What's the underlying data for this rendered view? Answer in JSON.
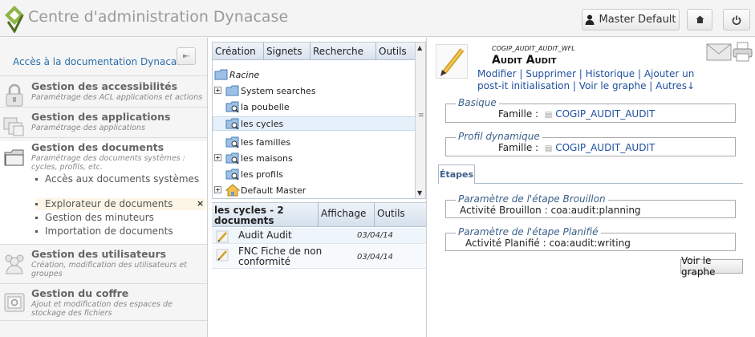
{
  "header": {
    "app_title": "Centre d'administration Dynacase",
    "user_label": "Master Default",
    "logo_icon": "dynacase-logo-icon",
    "user_icon": "user-icon",
    "home_icon": "home-icon",
    "power_icon": "power-icon"
  },
  "sidebar": {
    "doc_link": "Accès à la documentation Dynacase",
    "collapse_icon": "collapse-left-icon",
    "sections": [
      {
        "title": "Gestion des accessibilités",
        "subtitle": "Paramétrage des ACL applications et actions",
        "icon": "lock-icon"
      },
      {
        "title": "Gestion des applications",
        "subtitle": "Paramétrage des applications",
        "icon": "applications-icon"
      },
      {
        "title": "Gestion des documents",
        "subtitle": "Paramétrage des documents systèmes : cycles, profils, etc.",
        "icon": "documents-icon"
      },
      {
        "title": "Gestion des utilisateurs",
        "subtitle": "Création, modification des utilisateurs et groupes",
        "icon": "users-icon"
      },
      {
        "title": "Gestion du coffre",
        "subtitle": "Ajout et modification des espaces de stockage des fichiers",
        "icon": "vault-icon"
      }
    ],
    "doc_items": [
      "Accès aux documents systèmes",
      "Explorateur de documents",
      "Gestion des minuteurs",
      "Importation de documents"
    ],
    "close_mark": "×"
  },
  "explorer": {
    "menu": [
      "Création",
      "Signets",
      "Recherche",
      "Outils"
    ],
    "tree": [
      {
        "label": "Racine"
      },
      {
        "label": "System searches"
      },
      {
        "label": "la poubelle"
      },
      {
        "label": "les cycles"
      },
      {
        "label": "les familles"
      },
      {
        "label": "les maisons"
      },
      {
        "label": "les profils"
      },
      {
        "label": "Default Master"
      }
    ],
    "list_header": {
      "title": "les cycles - 2 documents",
      "col_display": "Affichage",
      "col_tools": "Outils"
    },
    "rows": [
      {
        "title": "Audit Audit",
        "date": "03/04/14"
      },
      {
        "title": "FNC Fiche de non conformité",
        "date": "03/04/14"
      }
    ],
    "scroll_up": "▲",
    "scroll_down": "▼",
    "scroll_grip": "≡"
  },
  "document": {
    "family": "COGIP_AUDIT_AUDIT_WFL",
    "title": "Audit Audit",
    "menu": [
      "Modifier",
      "Supprimer",
      "Historique",
      "Ajouter un post-it",
      "initialisation",
      "Voir le graphe",
      "Autres↓"
    ],
    "fieldsets": [
      {
        "legend": "Basique",
        "label": "Famille :",
        "value": "COGIP_AUDIT_AUDIT"
      },
      {
        "legend": "Profil dynamique",
        "label": "Famille :",
        "value": "COGIP_AUDIT_AUDIT"
      }
    ],
    "tab": "Étapes",
    "steps": [
      {
        "legend": "Paramètre de l'étape Brouillon",
        "label": "Activité Brouillon :",
        "value": "coa:audit:planning"
      },
      {
        "legend": "Paramètre de l'étape Planifié",
        "label": "Activité Planifié :",
        "value": "coa:audit:writing"
      }
    ],
    "graph_button": "Voir le graphe"
  }
}
